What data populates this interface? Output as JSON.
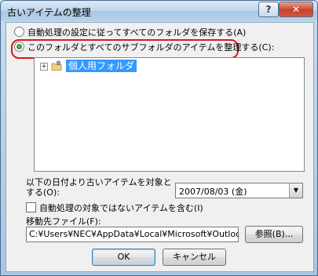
{
  "window": {
    "title": "古いアイテムの整理",
    "help_label": "?",
    "close_label": "✕"
  },
  "options": {
    "auto_archive_label": "自動処理の設定に従ってすべてのフォルダを保存する(A)",
    "this_folder_label": "このフォルダとすべてのサブフォルダのアイテムを整理する(C):"
  },
  "tree": {
    "expander": "+",
    "root_label": "個人用フォルダ"
  },
  "date": {
    "label_line1": "以下の日付より古いアイテムを対象と",
    "label_line2": "する(O):",
    "value": "2007/08/03 (金)",
    "dropdown_glyph": "▼"
  },
  "include_checkbox_label": "自動処理の対象ではないアイテムを含む(I)",
  "destination": {
    "label": "移動先ファイル(F):",
    "path": "C:¥Users¥NEC¥AppData¥Local¥Microsoft¥Outlook¥archive.pst",
    "browse_label": "参照(B)..."
  },
  "buttons": {
    "ok": "OK",
    "cancel": "キャンセル"
  }
}
